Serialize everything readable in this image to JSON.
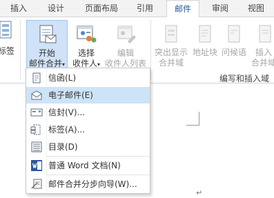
{
  "tabs": {
    "insert": "插入",
    "design": "设计",
    "layout": "页面布局",
    "references": "引用",
    "mailings": "邮件",
    "review": "审阅",
    "view": "视图"
  },
  "ribbon": {
    "labels_partial": "标签",
    "start_merge_line1": "开始",
    "start_merge_line2": "邮件合并",
    "select_recipients_line1": "选择",
    "select_recipients_line2": "收件人",
    "edit_recipients_line1": "编辑",
    "edit_recipients_line2": "收件人列表",
    "highlight_line1": "突出显示",
    "highlight_line2": "合并域",
    "address_block": "地址块",
    "greeting_line": "问候语",
    "insert_line1": "插入",
    "insert_line2": "合并域",
    "group_write_insert": "编写和插入域"
  },
  "menu": {
    "items": [
      {
        "label": "信函(L)",
        "icon": "letter-icon"
      },
      {
        "label": "电子邮件(E)",
        "icon": "email-icon"
      },
      {
        "label": "信封(V)...",
        "icon": "envelope-icon"
      },
      {
        "label": "标签(A)...",
        "icon": "labels-icon"
      },
      {
        "label": "目录(D)",
        "icon": "directory-icon"
      },
      {
        "label": "普通 Word 文档(N)",
        "icon": "word-document-icon"
      },
      {
        "label": "邮件合并分步向导(W)...",
        "icon": "mail-merge-wizard-icon"
      }
    ]
  },
  "doc": {
    "paragraph_mark": "↵"
  },
  "colors": {
    "accent": "#2b579a",
    "highlight": "#cde3f7",
    "pressed": "#cfe2f7"
  }
}
